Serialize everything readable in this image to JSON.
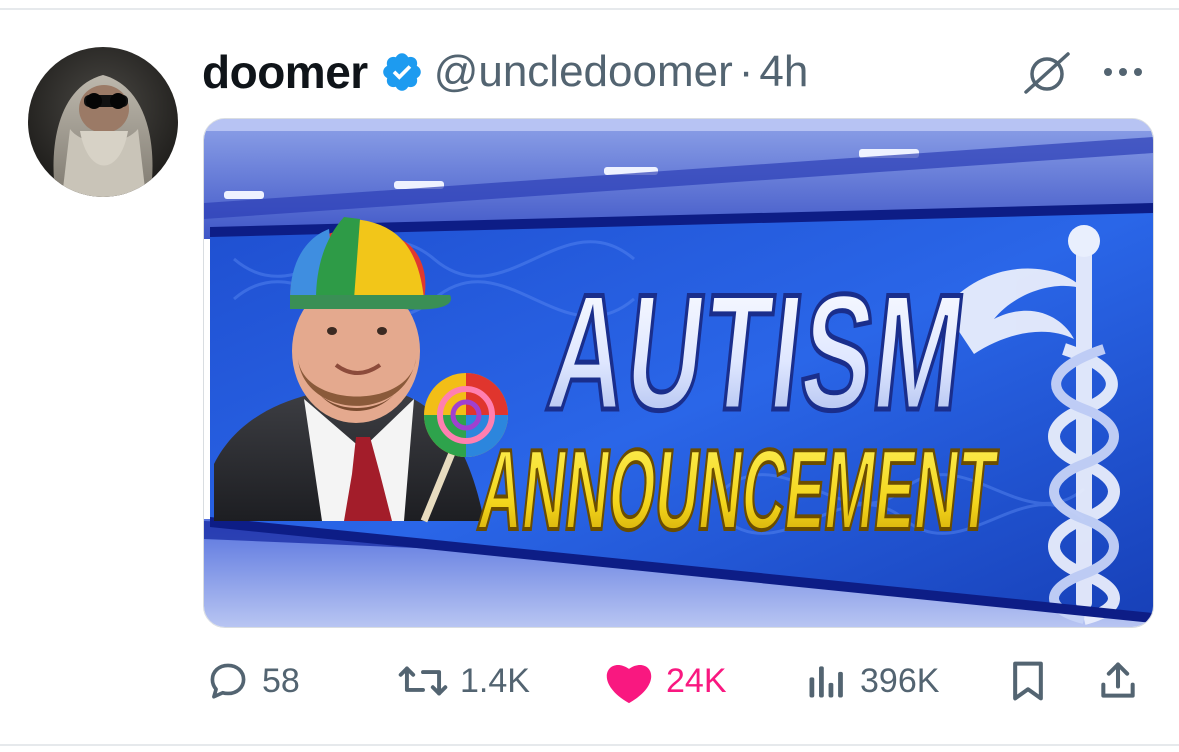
{
  "tweet": {
    "display_name": "doomer",
    "handle": "@uncledoomer",
    "separator": "·",
    "time": "4h",
    "verified": true,
    "icons": [
      "verified-badge-icon",
      "grok-icon",
      "more-icon"
    ]
  },
  "media": {
    "banner_line_1": "AUTISM",
    "banner_line_2": "ANNOUNCEMENT"
  },
  "actions": {
    "replies": "58",
    "reposts": "1.4K",
    "likes": "24K",
    "views": "396K",
    "liked": true
  },
  "colors": {
    "text_primary": "#0f1419",
    "text_secondary": "#536471",
    "verified_blue": "#1d9bf0",
    "like_pink": "#f91880"
  }
}
